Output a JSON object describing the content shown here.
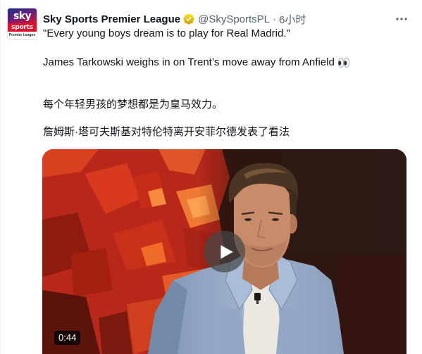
{
  "tweet": {
    "author": {
      "display_name": "Sky Sports Premier League",
      "handle": "@SkySportsPL",
      "separator": "·",
      "time": "6小时",
      "verified_icon": "verified-badge-gold-icon",
      "avatar": {
        "logo_top": "sky",
        "logo_middle": "sports",
        "logo_bottom": "Premier League"
      }
    },
    "more_icon": "more-horizontal-icon",
    "text": {
      "line1": "\"Every young boys dream is to play for Real Madrid.\"",
      "line2": "James Tarkowski weighs in on Trent’s move away from Anfield",
      "line2_emoji_icon": "eyes-emoji-icon",
      "line3": "每个年轻男孩的梦想都是为皇马效力。",
      "line4": "詹姆斯·塔可夫斯基对特伦特离开安菲尔德发表了看法"
    },
    "media": {
      "type": "video",
      "duration": "0:44",
      "play_icon": "play-icon"
    }
  },
  "colors": {
    "text_primary": "#0f1419",
    "text_secondary": "#536471",
    "verified_gold": "#e2b719",
    "background": "#ffffff"
  }
}
